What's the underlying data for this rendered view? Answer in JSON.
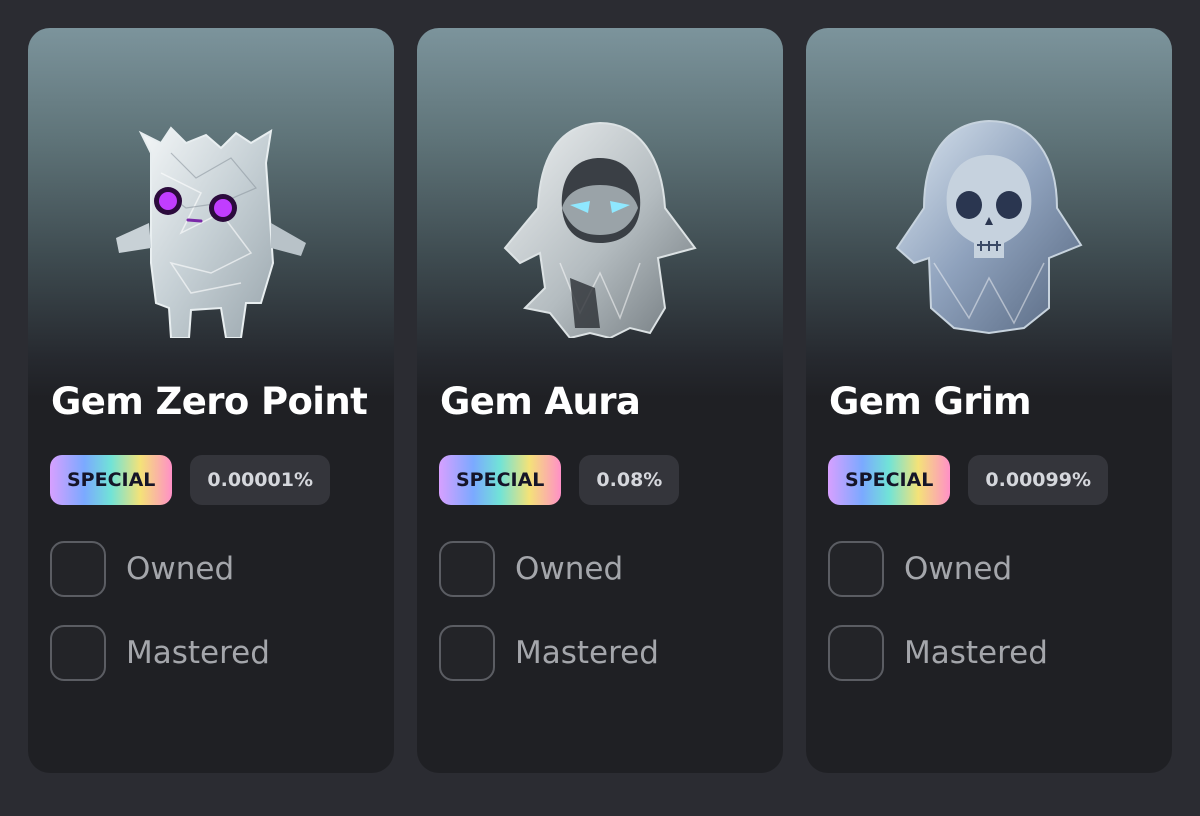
{
  "cards": [
    {
      "title": "Gem Zero Point",
      "rarity": "SPECIAL",
      "drop_rate": "0.00001%",
      "owned_label": "Owned",
      "mastered_label": "Mastered",
      "owned": false,
      "mastered": false,
      "figure_icon": "crystal-cube-creature-icon",
      "eye_color": "#c13dff"
    },
    {
      "title": "Gem Aura",
      "rarity": "SPECIAL",
      "drop_rate": "0.08%",
      "owned_label": "Owned",
      "mastered_label": "Mastered",
      "owned": false,
      "mastered": false,
      "figure_icon": "crystal-hooded-figure-icon",
      "eye_color": "#8fe8ff"
    },
    {
      "title": "Gem Grim",
      "rarity": "SPECIAL",
      "drop_rate": "0.00099%",
      "owned_label": "Owned",
      "mastered_label": "Mastered",
      "owned": false,
      "mastered": false,
      "figure_icon": "crystal-hooded-skull-icon",
      "eye_color": "#2a3650"
    }
  ]
}
